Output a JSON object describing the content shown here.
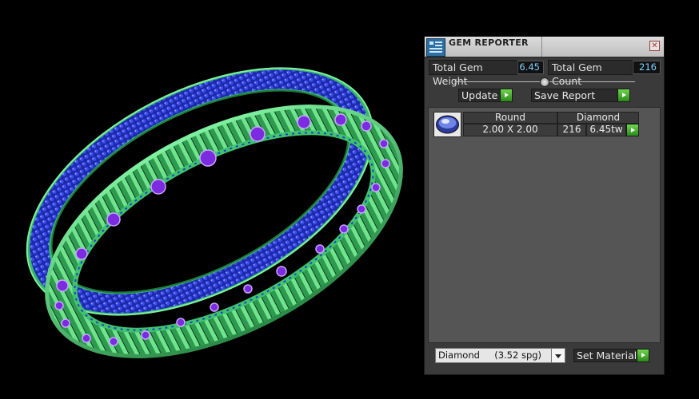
{
  "panel": {
    "title": "GEM REPORTER",
    "close_icon": "close-icon",
    "total_gem_weight_label": "Total Gem Weight",
    "total_gem_weight_value": "6.45",
    "total_gem_count_label": "Total Gem Count",
    "total_gem_count_value": "216",
    "update_label": "Update",
    "save_report_label": "Save Report",
    "list": {
      "headers": [
        "Round",
        "Diamond"
      ],
      "rows": [
        {
          "icon": "round-gem-icon",
          "size": "2.00 X 2.00",
          "count": "216",
          "weight": "6.45tw"
        }
      ]
    },
    "material_selected": "Diamond     (3.52 spg)",
    "set_material_label": "Set Material"
  },
  "colors": {
    "ring_green": "#3fc46b",
    "gem_blue": "#2a3ad8",
    "gem_purple": "#8a2ee0",
    "go_green": "#4cbf2f",
    "value_cyan": "#7fd0ff"
  }
}
